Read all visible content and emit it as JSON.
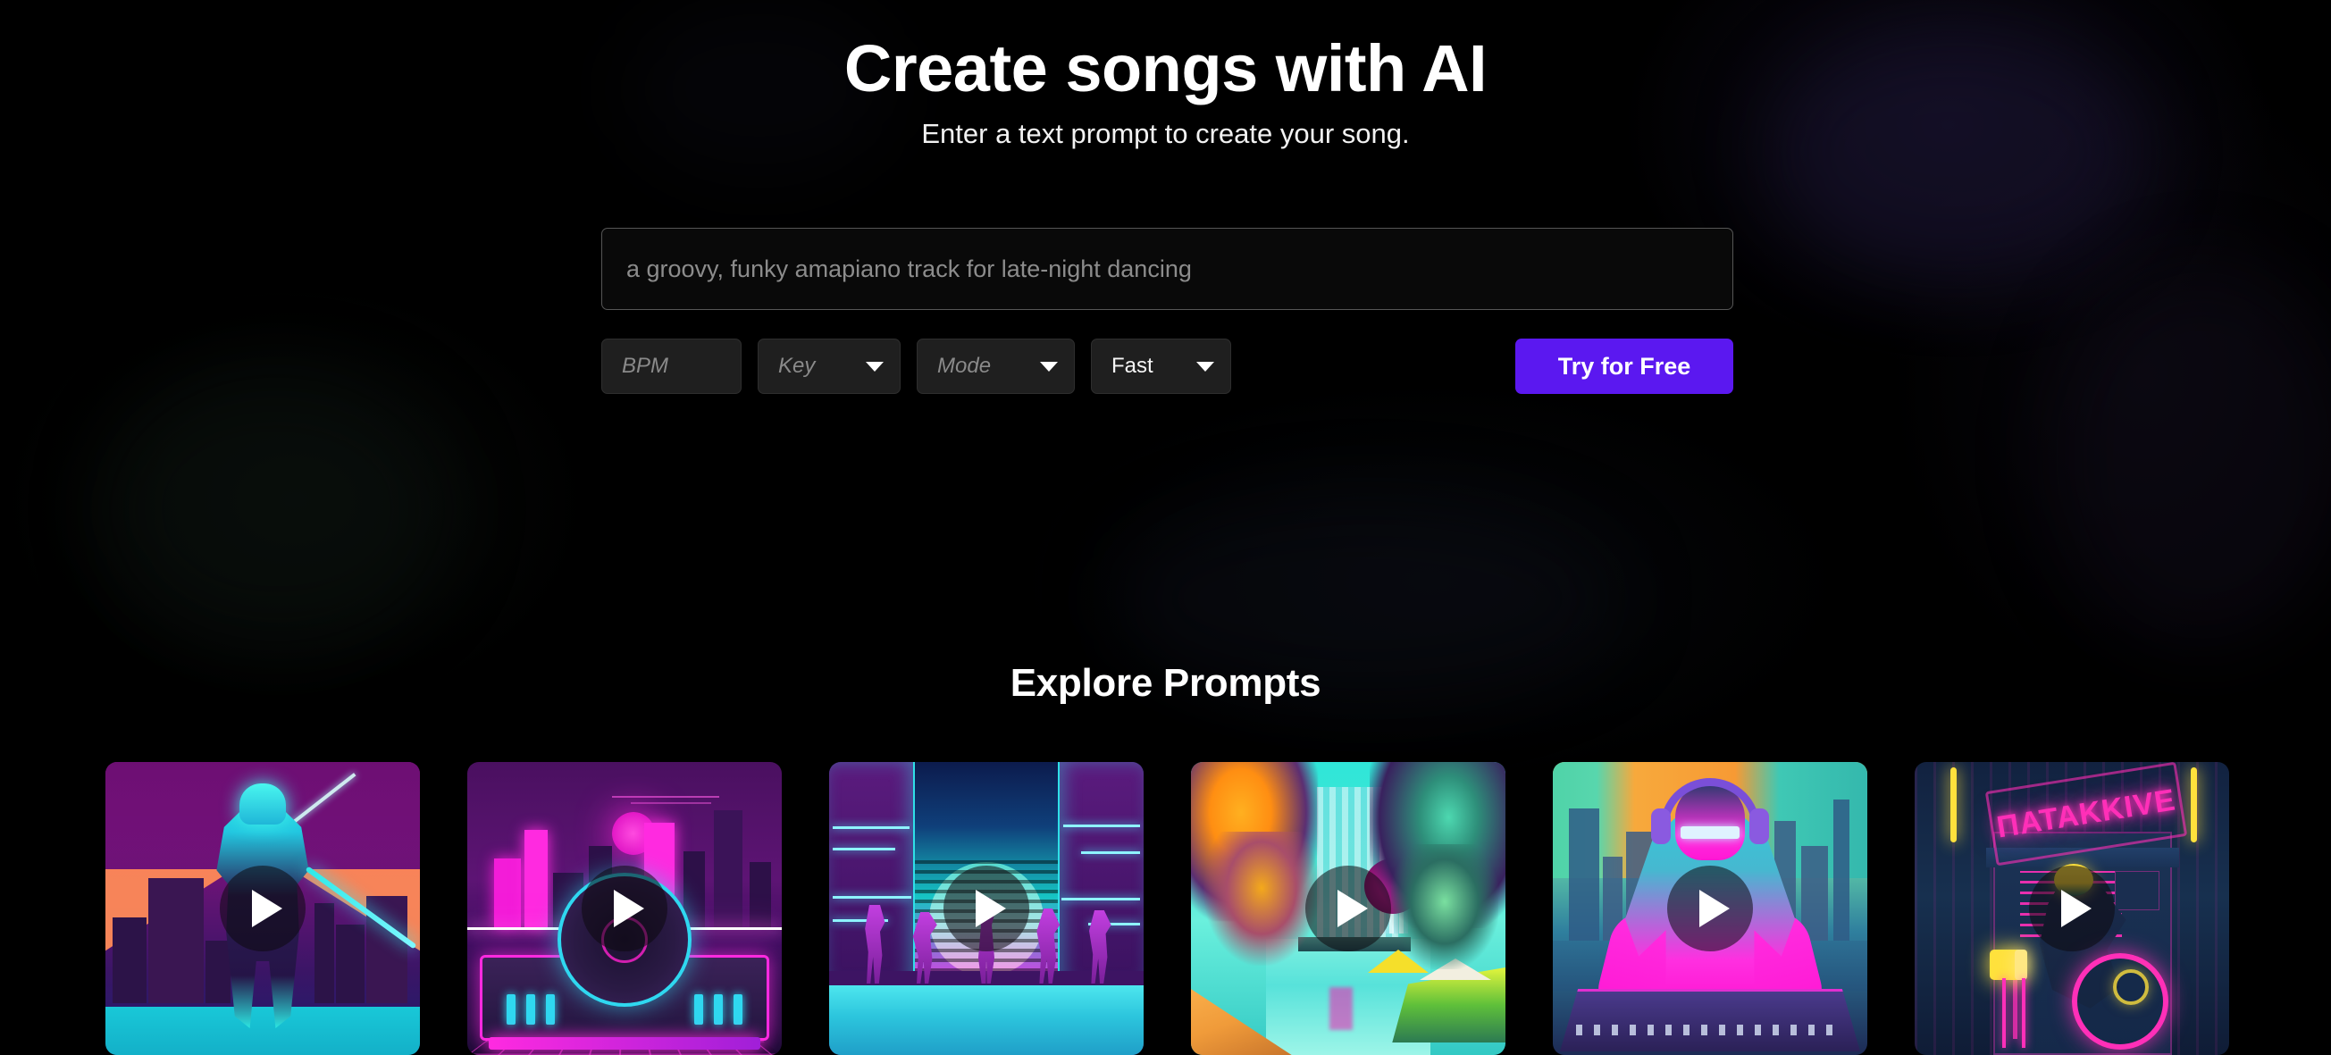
{
  "hero": {
    "title": "Create songs with AI",
    "subtitle": "Enter a text prompt to create your song."
  },
  "prompt": {
    "value": "a groovy, funky amapiano track for late-night dancing",
    "placeholder": "a groovy, funky amapiano track for late-night dancing"
  },
  "controls": {
    "bpm": {
      "label": "BPM",
      "placeholder": "BPM",
      "value": ""
    },
    "key": {
      "label": "Key",
      "placeholder": "Key",
      "value": "",
      "caret": "chevron-down-icon"
    },
    "mode": {
      "label": "Mode",
      "placeholder": "Mode",
      "value": "",
      "caret": "chevron-down-icon"
    },
    "speed": {
      "label": "Fast",
      "value": "Fast",
      "caret": "chevron-down-icon"
    },
    "cta": {
      "label": "Try for Free"
    }
  },
  "explore": {
    "title": "Explore Prompts",
    "cards": [
      {
        "name": "cyber-samurai",
        "play": "play-icon"
      },
      {
        "name": "synthwave-turntable",
        "play": "play-icon"
      },
      {
        "name": "neon-dancers",
        "play": "play-icon"
      },
      {
        "name": "tropical-canal",
        "play": "play-icon"
      },
      {
        "name": "dj-headphones",
        "play": "play-icon"
      },
      {
        "name": "neon-sign-bike",
        "play": "play-icon",
        "sign_text": "ΠΑΤΑΚΚΙVΕ"
      }
    ]
  },
  "colors": {
    "background": "#000000",
    "accent": "#5b18f0",
    "text_primary": "#ffffff",
    "text_muted": "#8c8c8c",
    "input_border": "#565656",
    "control_bg": "#1f1f1f"
  }
}
